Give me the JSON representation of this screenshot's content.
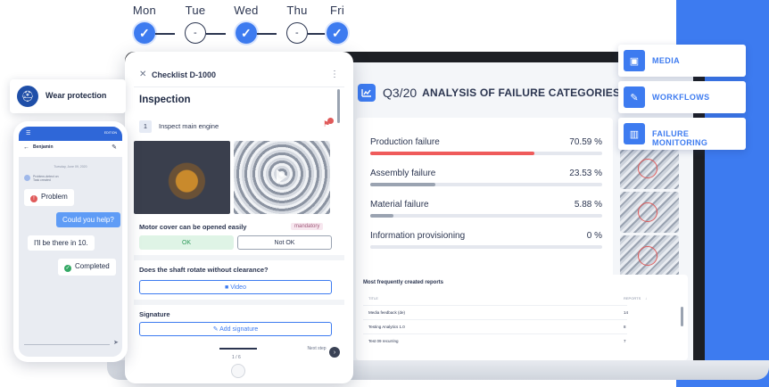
{
  "week": {
    "days": [
      {
        "label": "Mon",
        "state": "done",
        "mark": "✓"
      },
      {
        "label": "Tue",
        "state": "open",
        "mark": "-"
      },
      {
        "label": "Wed",
        "state": "done",
        "mark": "✓"
      },
      {
        "label": "Thu",
        "state": "open",
        "mark": "-"
      },
      {
        "label": "Fri",
        "state": "done",
        "mark": "✓"
      }
    ]
  },
  "features": [
    {
      "label": "MEDIA",
      "icon": "media-icon",
      "glyph": "▣"
    },
    {
      "label": "WORKFLOWS",
      "icon": "wrench-icon",
      "glyph": "✎"
    },
    {
      "label": "FAILURE MONITORING",
      "icon": "chart-icon",
      "glyph": "▥"
    }
  ],
  "dashboard": {
    "quarter": "Q3/20",
    "title": "ANALYSIS OF FAILURE CATEGORIES",
    "bars": [
      {
        "label": "Production failure",
        "value": "70.59 %",
        "fraction": 0.706,
        "color": "#ef5b5b"
      },
      {
        "label": "Assembly failure",
        "value": "23.53 %",
        "fraction": 0.28,
        "color": "#9aa3b1"
      },
      {
        "label": "Material failure",
        "value": "5.88 %",
        "fraction": 0.1,
        "color": "#9aa3b1"
      },
      {
        "label": "Information provisioning",
        "value": "0 %",
        "fraction": 0.0,
        "color": "#9aa3b1"
      }
    ],
    "reports": {
      "title": "Most frequently created reports",
      "col_title": "TITLE",
      "col_reports": "REPORTS",
      "sort_glyph": "↓",
      "rows": [
        {
          "title": "Media feedback (de)",
          "count": "14"
        },
        {
          "title": "Testing Analytics 1.0",
          "count": "8"
        },
        {
          "title": "Test 09 recurring",
          "count": "7"
        }
      ]
    }
  },
  "tablet": {
    "close_glyph": "✕",
    "header_title": "Checklist D-1000",
    "more_glyph": "⋮",
    "section": "Inspection",
    "step_number": "1",
    "step_label": "Inspect main engine",
    "step_flag_glyph": "⚑",
    "question1": "Motor cover can be opened easily",
    "mandatory": "mandatory",
    "ok_label": "OK",
    "notok_label": "Not OK",
    "question2": "Does the shaft rotate without clearance?",
    "video_label": "■ Video",
    "signature_heading": "Signature",
    "signature_button": "✎ Add signature",
    "pager": "1 / 6",
    "next_step": "Next step",
    "next_glyph": "›"
  },
  "wear": {
    "label": "Wear protection",
    "glyph": "⛑"
  },
  "phone": {
    "edition": "EDITION",
    "menu_glyph": "☰",
    "back_glyph": "←",
    "contact": "Benjamin",
    "edit_glyph": "✎",
    "date": "Tuesday, June 09, 2020",
    "system_line1": "Problem-detect on",
    "system_line2": "Task created",
    "problem": "Problem",
    "problem_glyph": "!",
    "question": "Could you help?",
    "answer": "I'll be there in 10.",
    "completed": "Completed",
    "completed_glyph": "✓",
    "send_glyph": "➤"
  }
}
